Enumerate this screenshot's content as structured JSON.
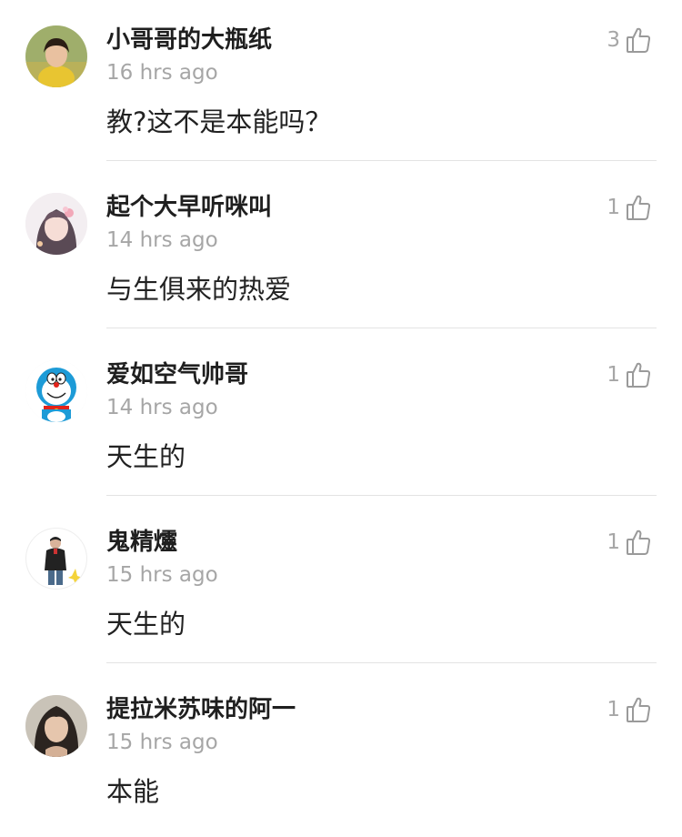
{
  "comments": [
    {
      "username": "小哥哥的大瓶纸",
      "time": "16 hrs ago",
      "text": "教?这不是本能吗？",
      "likes": "3",
      "avatar_icon": "child-portrait-avatar"
    },
    {
      "username": "起个大早听咪叫",
      "time": "14 hrs ago",
      "text": "与生俱来的热爱",
      "likes": "1",
      "avatar_icon": "anime-girl-avatar"
    },
    {
      "username": "爱如空气帅哥",
      "time": "14 hrs ago",
      "text": "天生的",
      "likes": "1",
      "avatar_icon": "doraemon-avatar"
    },
    {
      "username": "鬼精爧",
      "time": "15 hrs ago",
      "text": "天生的",
      "likes": "1",
      "avatar_icon": "figure-avatar"
    },
    {
      "username": "提拉米苏味的阿一",
      "time": "15 hrs ago",
      "text": "本能",
      "likes": "1",
      "avatar_icon": "woman-portrait-avatar"
    }
  ],
  "colors": {
    "name": "#1f1f1f",
    "meta": "#a6a6a6",
    "divider": "#e3e3e3"
  }
}
